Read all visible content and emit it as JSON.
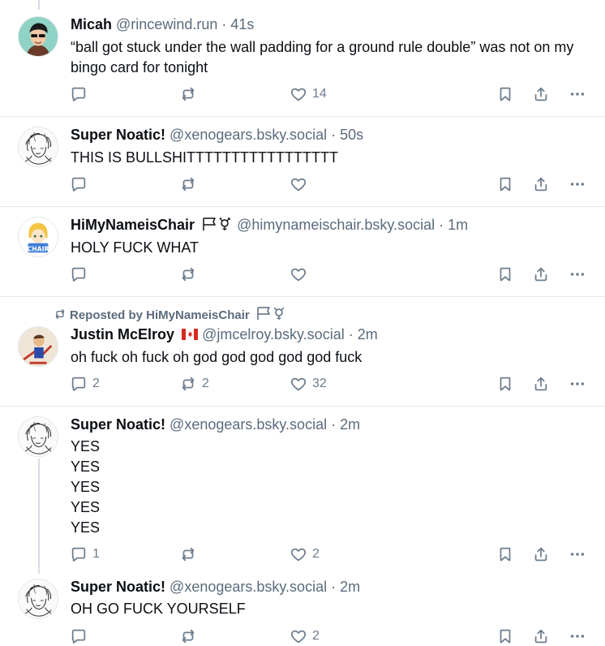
{
  "posts": [
    {
      "name": "Micah",
      "handle": "@rincewind.run",
      "time": "41s",
      "text": "“ball got stuck under the wall padding for a ground rule double” was not on my bingo card for tonight",
      "replies": "",
      "reposts": "",
      "likes": "14"
    },
    {
      "name": "Super Noatic!",
      "handle": "@xenogears.bsky.social",
      "time": "50s",
      "text": "THIS IS BULLSHITTTTTTTTTTTTTTTTT",
      "replies": "",
      "reposts": "",
      "likes": ""
    },
    {
      "name": "HiMyNameisChair",
      "handle": "@himynameischair.bsky.social",
      "time": "1m",
      "text": "HOLY FUCK WHAT",
      "replies": "",
      "reposts": "",
      "likes": ""
    },
    {
      "name": "Justin McElroy",
      "handle": "@jmcelroy.bsky.social",
      "time": "2m",
      "text": "oh fuck oh fuck oh god god god god god fuck",
      "replies": "2",
      "reposts": "2",
      "likes": "32",
      "reposted_by": "Reposted by HiMyNameisChair"
    },
    {
      "name": "Super Noatic!",
      "handle": "@xenogears.bsky.social",
      "time": "2m",
      "text": "YES\nYES\nYES\nYES\nYES",
      "replies": "1",
      "reposts": "",
      "likes": "2"
    },
    {
      "name": "Super Noatic!",
      "handle": "@xenogears.bsky.social",
      "time": "2m",
      "text": "OH GO FUCK YOURSELF",
      "replies": "",
      "reposts": "",
      "likes": "2"
    }
  ],
  "icons": {
    "reply": "reply-icon",
    "repost": "repost-icon",
    "like": "heart-icon",
    "bookmark": "bookmark-icon",
    "share": "share-icon",
    "more": "more-icon"
  },
  "colors": {
    "muted": "#5b6b7d",
    "icon": "#6d7c8d",
    "divider": "#e6e9ee"
  }
}
